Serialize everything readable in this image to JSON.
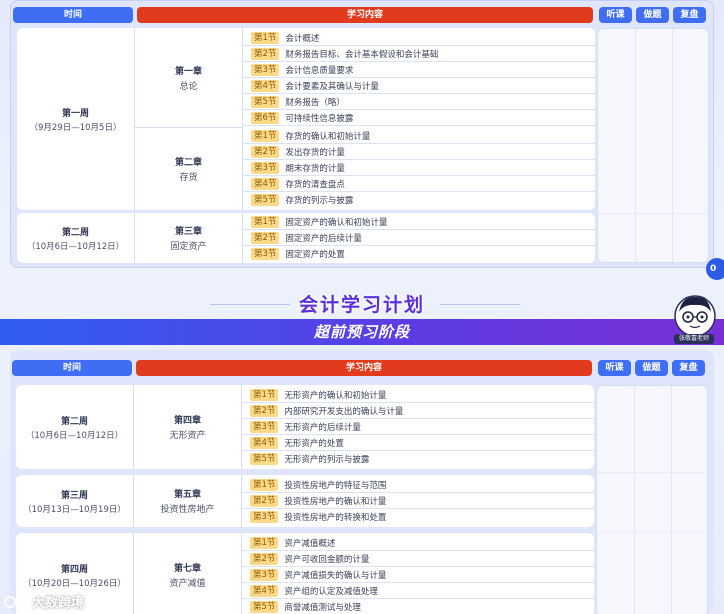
{
  "header": {
    "time": "时间",
    "content": "学习内容",
    "listen": "听课",
    "practice": "做题",
    "review": "复盘"
  },
  "banner": {
    "title": "会计学习计划",
    "subtitle": "超前预习阶段",
    "avatar_label": "张敬富老师"
  },
  "float_badge": "0",
  "watermark": "张敬富老师",
  "logo_text": "大数跨境",
  "panel1": {
    "weeks": [
      {
        "name": "第一周",
        "dates": "（9月29日—10月5日）",
        "chapters": [
          {
            "name": "第一章",
            "title": "总论",
            "sections": [
              {
                "badge": "第1节",
                "title": "会计概述"
              },
              {
                "badge": "第2节",
                "title": "财务报告目标、会计基本假设和会计基础"
              },
              {
                "badge": "第3节",
                "title": "会计信息质量要求"
              },
              {
                "badge": "第4节",
                "title": "会计要素及其确认与计量"
              },
              {
                "badge": "第5节",
                "title": "财务报告（略）"
              },
              {
                "badge": "第6节",
                "title": "可持续性信息披露"
              }
            ]
          },
          {
            "name": "第二章",
            "title": "存货",
            "sections": [
              {
                "badge": "第1节",
                "title": "存货的确认和初始计量"
              },
              {
                "badge": "第2节",
                "title": "发出存货的计量"
              },
              {
                "badge": "第3节",
                "title": "期末存货的计量"
              },
              {
                "badge": "第4节",
                "title": "存货的清查盘点"
              },
              {
                "badge": "第5节",
                "title": "存货的列示与披露"
              }
            ]
          }
        ]
      },
      {
        "name": "第二周",
        "dates": "（10月6日—10月12日）",
        "chapters": [
          {
            "name": "第三章",
            "title": "固定资产",
            "sections": [
              {
                "badge": "第1节",
                "title": "固定资产的确认和初始计量"
              },
              {
                "badge": "第2节",
                "title": "固定资产的后续计量"
              },
              {
                "badge": "第3节",
                "title": "固定资产的处置"
              }
            ]
          }
        ]
      }
    ]
  },
  "panel2": {
    "weeks": [
      {
        "name": "第二周",
        "dates": "（10月6日—10月12日）",
        "chapters": [
          {
            "name": "第四章",
            "title": "无形资产",
            "sections": [
              {
                "badge": "第1节",
                "title": "无形资产的确认和初始计量"
              },
              {
                "badge": "第2节",
                "title": "内部研究开发支出的确认与计量"
              },
              {
                "badge": "第3节",
                "title": "无形资产的后续计量"
              },
              {
                "badge": "第4节",
                "title": "无形资产的处置"
              },
              {
                "badge": "第5节",
                "title": "无形资产的列示与披露"
              }
            ]
          }
        ]
      },
      {
        "name": "第三周",
        "dates": "（10月13日—10月19日）",
        "chapters": [
          {
            "name": "第五章",
            "title": "投资性房地产",
            "sections": [
              {
                "badge": "第1节",
                "title": "投资性房地产的特征与范围"
              },
              {
                "badge": "第2节",
                "title": "投资性房地产的确认和计量"
              },
              {
                "badge": "第3节",
                "title": "投资性房地产的转换和处置"
              }
            ]
          }
        ]
      },
      {
        "name": "第四周",
        "dates": "（10月20日—10月26日）",
        "chapters": [
          {
            "name": "第七章",
            "title": "资产减值",
            "sections": [
              {
                "badge": "第1节",
                "title": "资产减值概述"
              },
              {
                "badge": "第2节",
                "title": "资产可收回金额的计量"
              },
              {
                "badge": "第3节",
                "title": "资产减值损失的确认与计量"
              },
              {
                "badge": "第4节",
                "title": "资产组的认定及减值处理"
              },
              {
                "badge": "第5节",
                "title": "商誉减值测试与处理"
              }
            ]
          }
        ]
      }
    ]
  }
}
